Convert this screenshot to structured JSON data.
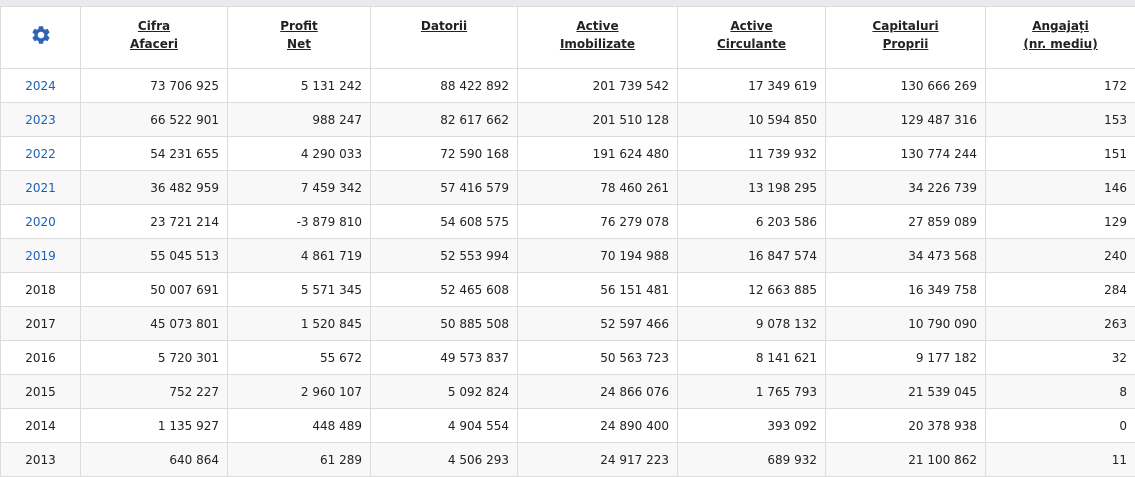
{
  "header": {
    "settings_icon": "gear-icon",
    "columns": [
      {
        "line1": "Cifra",
        "line2": "Afaceri"
      },
      {
        "line1": "Profit",
        "line2": "Net"
      },
      {
        "line1": "Datorii",
        "line2": ""
      },
      {
        "line1": "Active",
        "line2": "Imobilizate"
      },
      {
        "line1": "Active",
        "line2": "Circulante"
      },
      {
        "line1": "Capitaluri",
        "line2": "Proprii"
      },
      {
        "line1": "Angajați",
        "line2": "(nr. mediu)"
      }
    ]
  },
  "colors": {
    "link": "#1a62b8",
    "gear": "#2f63b8",
    "row_alt": "#f8f8f8",
    "border": "#dcdcdc"
  },
  "rows": [
    {
      "year": "2024",
      "linked": true,
      "values": [
        "73 706 925",
        "5 131 242",
        "88 422 892",
        "201 739 542",
        "17 349 619",
        "130 666 269",
        "172"
      ]
    },
    {
      "year": "2023",
      "linked": true,
      "values": [
        "66 522 901",
        "988 247",
        "82 617 662",
        "201 510 128",
        "10 594 850",
        "129 487 316",
        "153"
      ]
    },
    {
      "year": "2022",
      "linked": true,
      "values": [
        "54 231 655",
        "4 290 033",
        "72 590 168",
        "191 624 480",
        "11 739 932",
        "130 774 244",
        "151"
      ]
    },
    {
      "year": "2021",
      "linked": true,
      "values": [
        "36 482 959",
        "7 459 342",
        "57 416 579",
        "78 460 261",
        "13 198 295",
        "34 226 739",
        "146"
      ]
    },
    {
      "year": "2020",
      "linked": true,
      "values": [
        "23 721 214",
        "-3 879 810",
        "54 608 575",
        "76 279 078",
        "6 203 586",
        "27 859 089",
        "129"
      ]
    },
    {
      "year": "2019",
      "linked": true,
      "values": [
        "55 045 513",
        "4 861 719",
        "52 553 994",
        "70 194 988",
        "16 847 574",
        "34 473 568",
        "240"
      ]
    },
    {
      "year": "2018",
      "linked": false,
      "values": [
        "50 007 691",
        "5 571 345",
        "52 465 608",
        "56 151 481",
        "12 663 885",
        "16 349 758",
        "284"
      ]
    },
    {
      "year": "2017",
      "linked": false,
      "values": [
        "45 073 801",
        "1 520 845",
        "50 885 508",
        "52 597 466",
        "9 078 132",
        "10 790 090",
        "263"
      ]
    },
    {
      "year": "2016",
      "linked": false,
      "values": [
        "5 720 301",
        "55 672",
        "49 573 837",
        "50 563 723",
        "8 141 621",
        "9 177 182",
        "32"
      ]
    },
    {
      "year": "2015",
      "linked": false,
      "values": [
        "752 227",
        "2 960 107",
        "5 092 824",
        "24 866 076",
        "1 765 793",
        "21 539 045",
        "8"
      ]
    },
    {
      "year": "2014",
      "linked": false,
      "values": [
        "1 135 927",
        "448 489",
        "4 904 554",
        "24 890 400",
        "393 092",
        "20 378 938",
        "0"
      ]
    },
    {
      "year": "2013",
      "linked": false,
      "values": [
        "640 864",
        "61 289",
        "4 506 293",
        "24 917 223",
        "689 932",
        "21 100 862",
        "11"
      ]
    }
  ]
}
